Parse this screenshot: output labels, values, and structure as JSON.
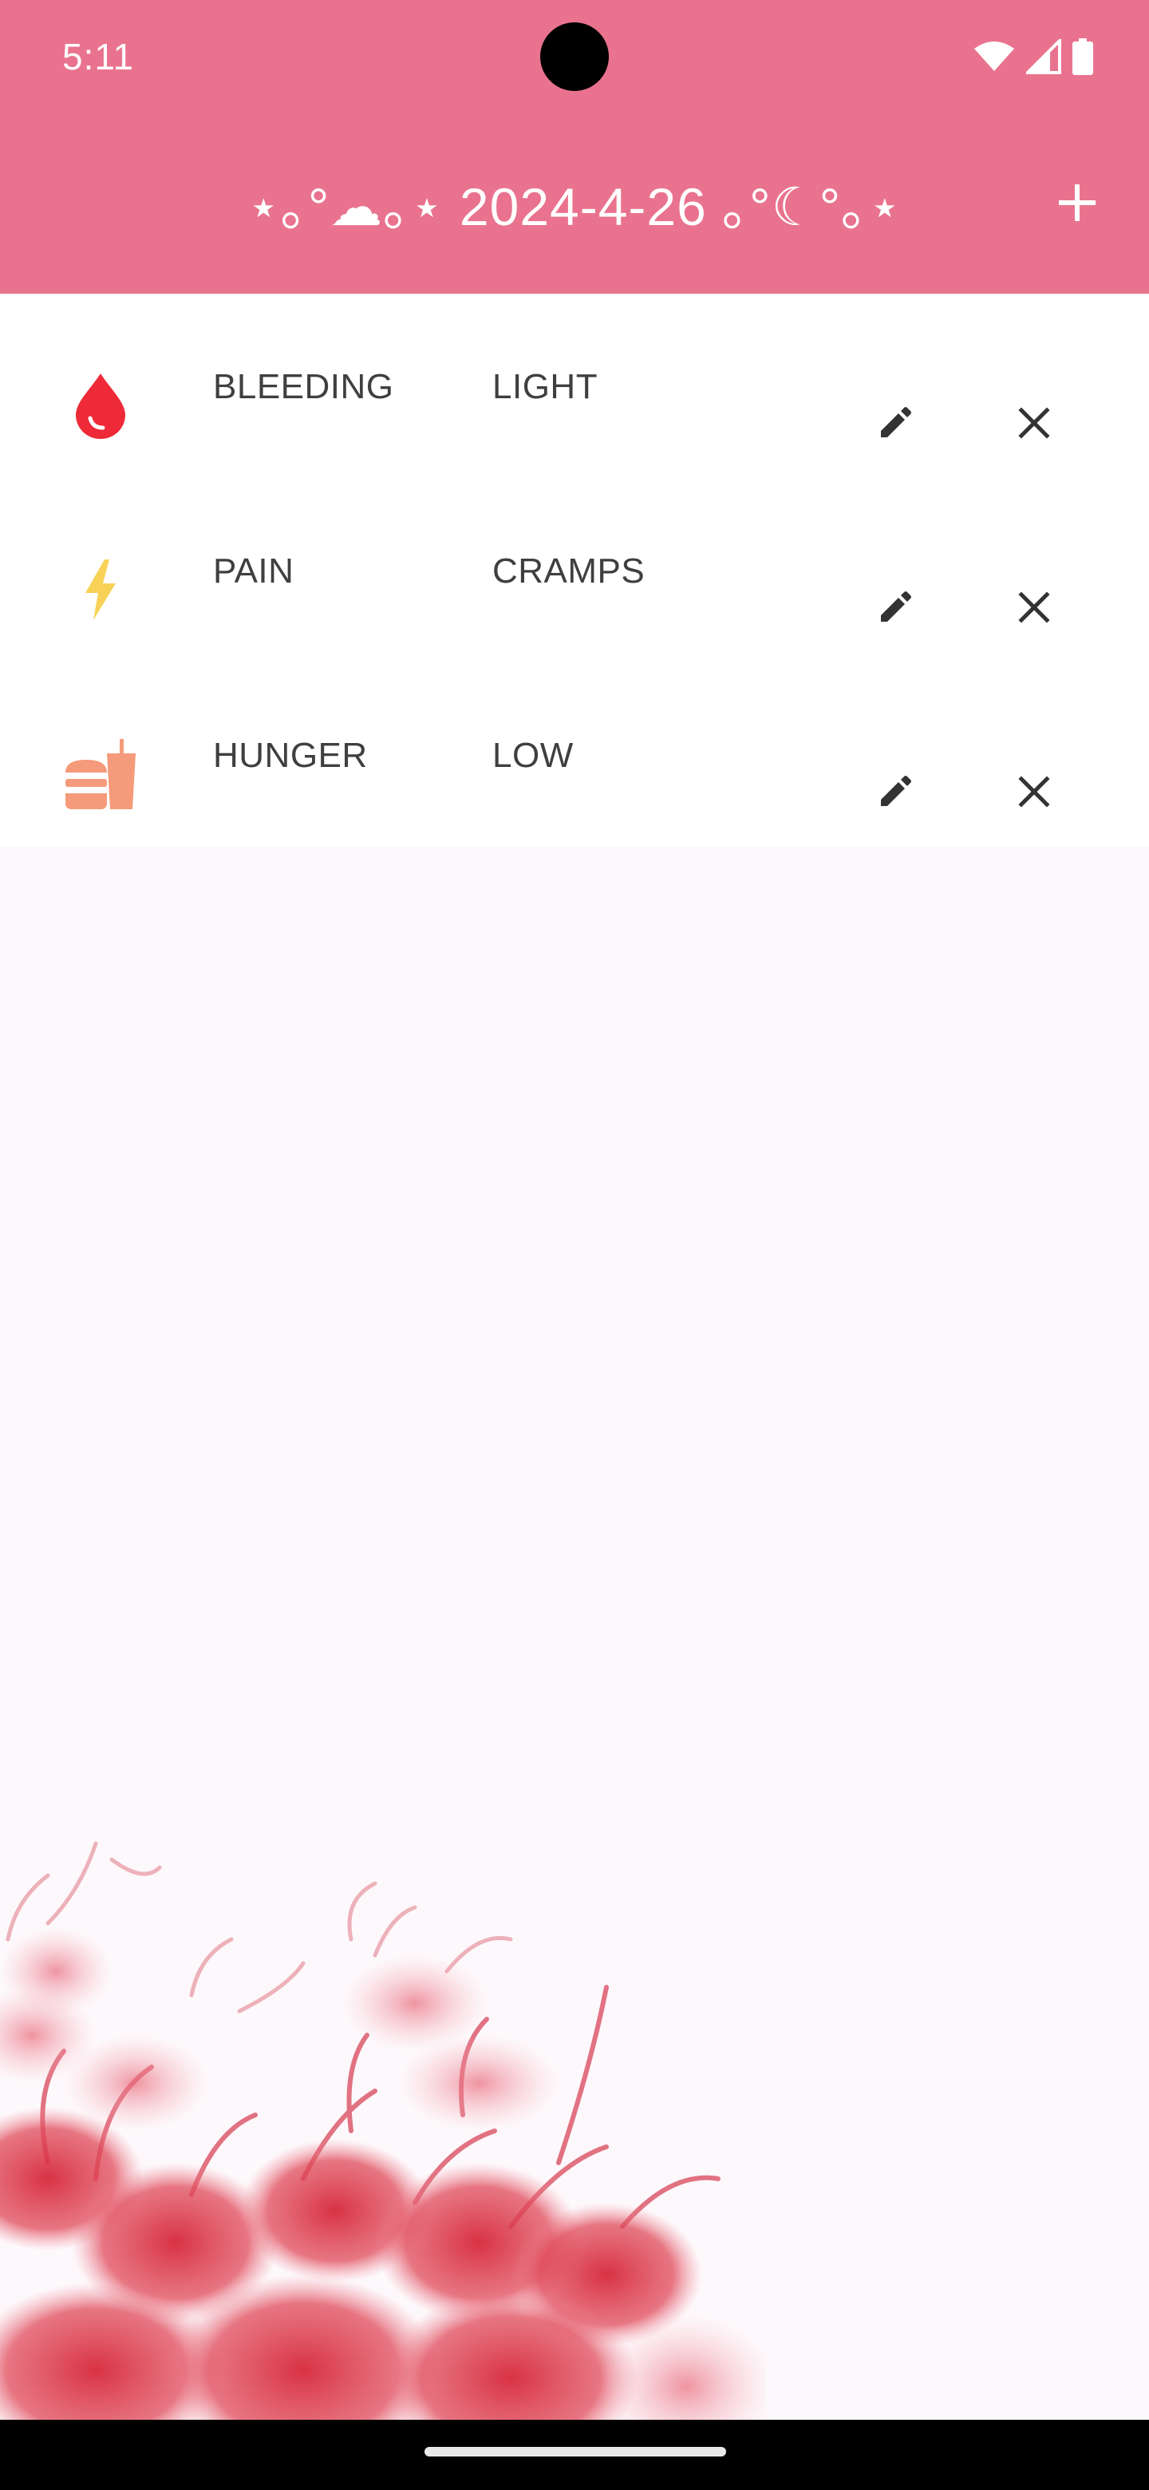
{
  "status_bar": {
    "time": "5:11",
    "icons": [
      "wifi-icon",
      "signal-icon",
      "battery-icon"
    ]
  },
  "app_bar": {
    "title": "⋆｡°☁︎｡⋆ 2024-4-26 ｡°☾°｡⋆",
    "add_icon": "plus-icon"
  },
  "entries": [
    {
      "icon": "blood-drop-icon",
      "name": "BLEEDING",
      "value": "LIGHT"
    },
    {
      "icon": "lightning-icon",
      "name": "PAIN",
      "value": "CRAMPS"
    },
    {
      "icon": "fastfood-icon",
      "name": "HUNGER",
      "value": "LOW"
    }
  ],
  "colors": {
    "app_bar": "#e9738e",
    "background": "#fdf8fb",
    "bleeding_icon": "#ee2a38",
    "pain_icon": "#f7d257",
    "hunger_icon": "#f59a7a",
    "text": "#3f3f3f"
  }
}
